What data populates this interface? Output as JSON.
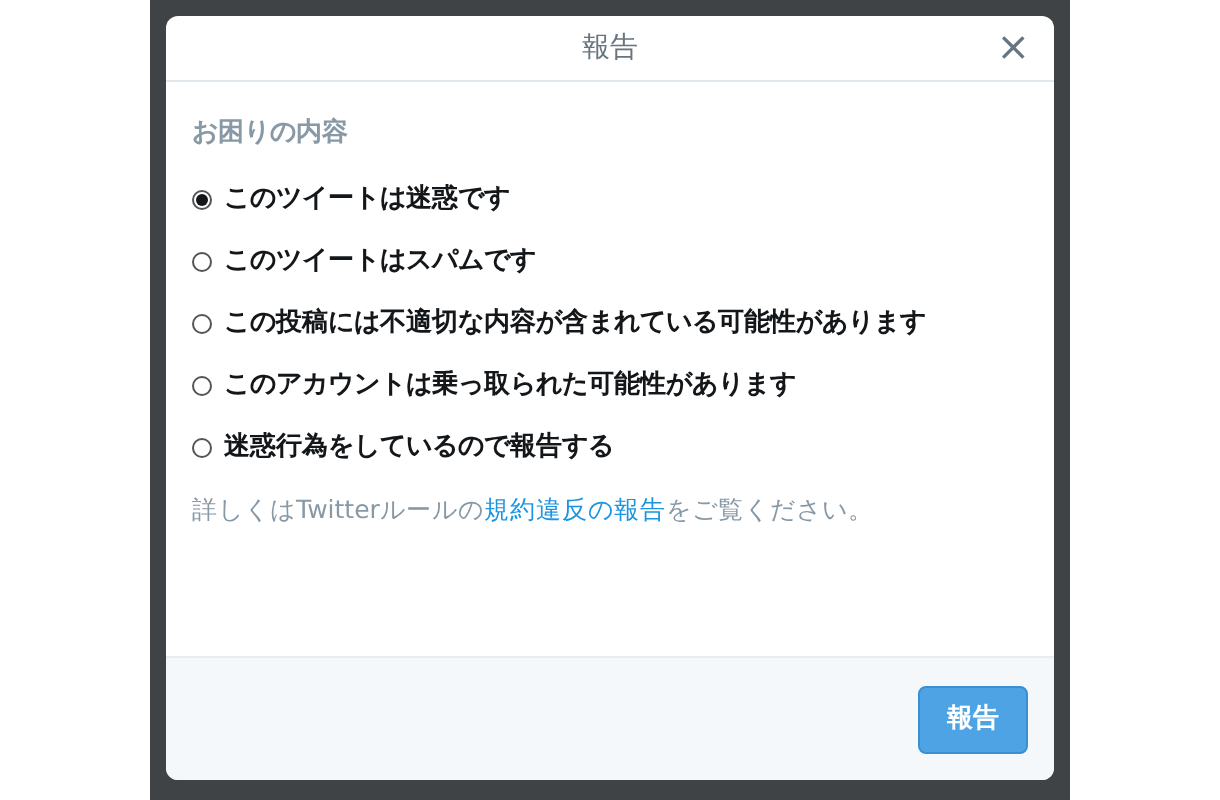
{
  "dialog": {
    "title": "報告",
    "close": "×",
    "section_label": "お困りの内容",
    "options": [
      {
        "label": "このツイートは迷惑です",
        "selected": true
      },
      {
        "label": "このツイートはスパムです",
        "selected": false
      },
      {
        "label": "この投稿には不適切な内容が含まれている可能性があります",
        "selected": false
      },
      {
        "label": "このアカウントは乗っ取られた可能性があります",
        "selected": false
      },
      {
        "label": "迷惑行為をしているので報告する",
        "selected": false
      }
    ],
    "note": {
      "before": "詳しくはTwitterルールの",
      "link": "規約違反の報告",
      "after": "をご覧ください。"
    },
    "submit": "報告"
  }
}
